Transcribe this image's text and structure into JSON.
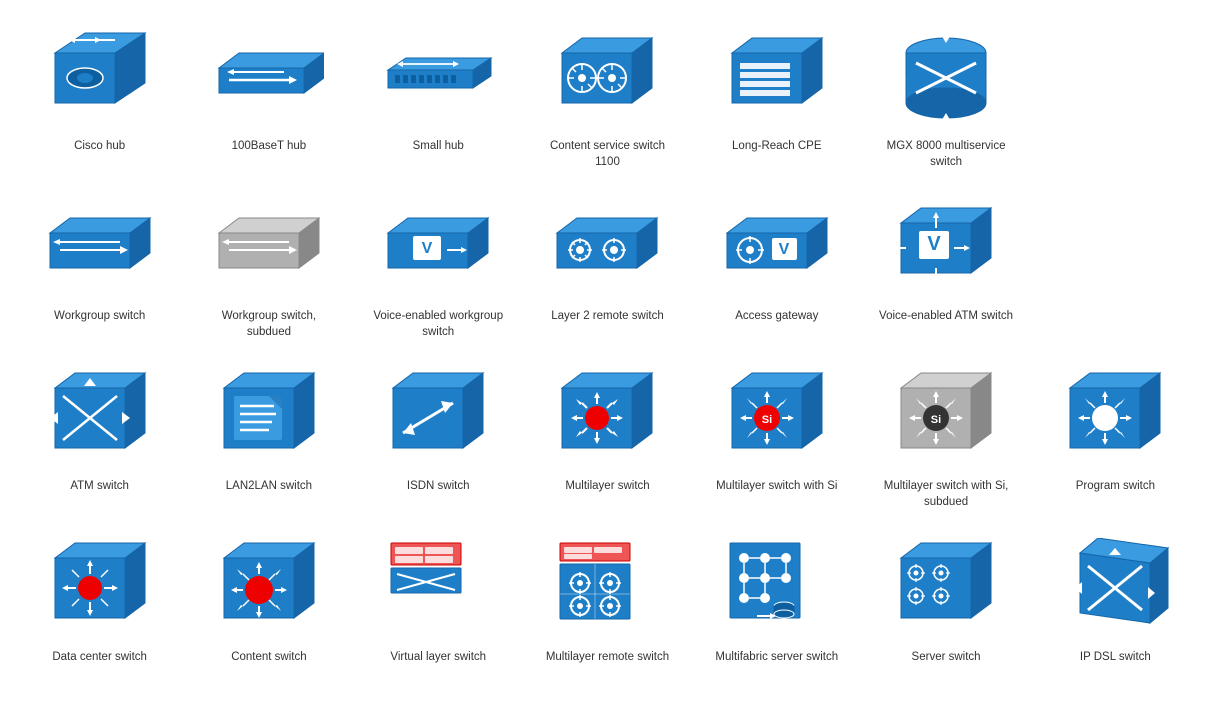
{
  "items": [
    {
      "id": "cisco-hub",
      "label": "Cisco hub"
    },
    {
      "id": "100baset-hub",
      "label": "100BaseT hub"
    },
    {
      "id": "small-hub",
      "label": "Small hub"
    },
    {
      "id": "content-service-switch-1100",
      "label": "Content service switch 1100"
    },
    {
      "id": "long-reach-cpe",
      "label": "Long-Reach CPE"
    },
    {
      "id": "mgx-8000",
      "label": "MGX 8000 multiservice switch"
    },
    {
      "id": "spacer1",
      "label": ""
    },
    {
      "id": "workgroup-switch",
      "label": "Workgroup switch"
    },
    {
      "id": "workgroup-switch-subdued",
      "label": "Workgroup switch, subdued"
    },
    {
      "id": "voice-enabled-workgroup-switch",
      "label": "Voice-enabled workgroup switch"
    },
    {
      "id": "layer-2-remote-switch",
      "label": "Layer 2 remote switch"
    },
    {
      "id": "access-gateway",
      "label": "Access gateway"
    },
    {
      "id": "voice-enabled-atm-switch",
      "label": "Voice-enabled ATM switch"
    },
    {
      "id": "spacer2",
      "label": ""
    },
    {
      "id": "atm-switch",
      "label": "ATM switch"
    },
    {
      "id": "lan2lan-switch",
      "label": "LAN2LAN switch"
    },
    {
      "id": "isdn-switch",
      "label": "ISDN switch"
    },
    {
      "id": "multilayer-switch",
      "label": "Multilayer switch"
    },
    {
      "id": "multilayer-switch-si",
      "label": "Multilayer switch with Si"
    },
    {
      "id": "multilayer-switch-si-subdued",
      "label": "Multilayer switch with Si, subdued"
    },
    {
      "id": "program-switch",
      "label": "Program switch"
    },
    {
      "id": "data-center-switch",
      "label": "Data center switch"
    },
    {
      "id": "content-switch",
      "label": "Content switch"
    },
    {
      "id": "virtual-layer-switch",
      "label": "Virtual layer switch"
    },
    {
      "id": "multilayer-remote-switch",
      "label": "Multilayer remote switch"
    },
    {
      "id": "multifabric-server-switch",
      "label": "Multifabric server switch"
    },
    {
      "id": "server-switch",
      "label": "Server switch"
    },
    {
      "id": "ip-dsl-switch",
      "label": "IP DSL switch"
    }
  ]
}
